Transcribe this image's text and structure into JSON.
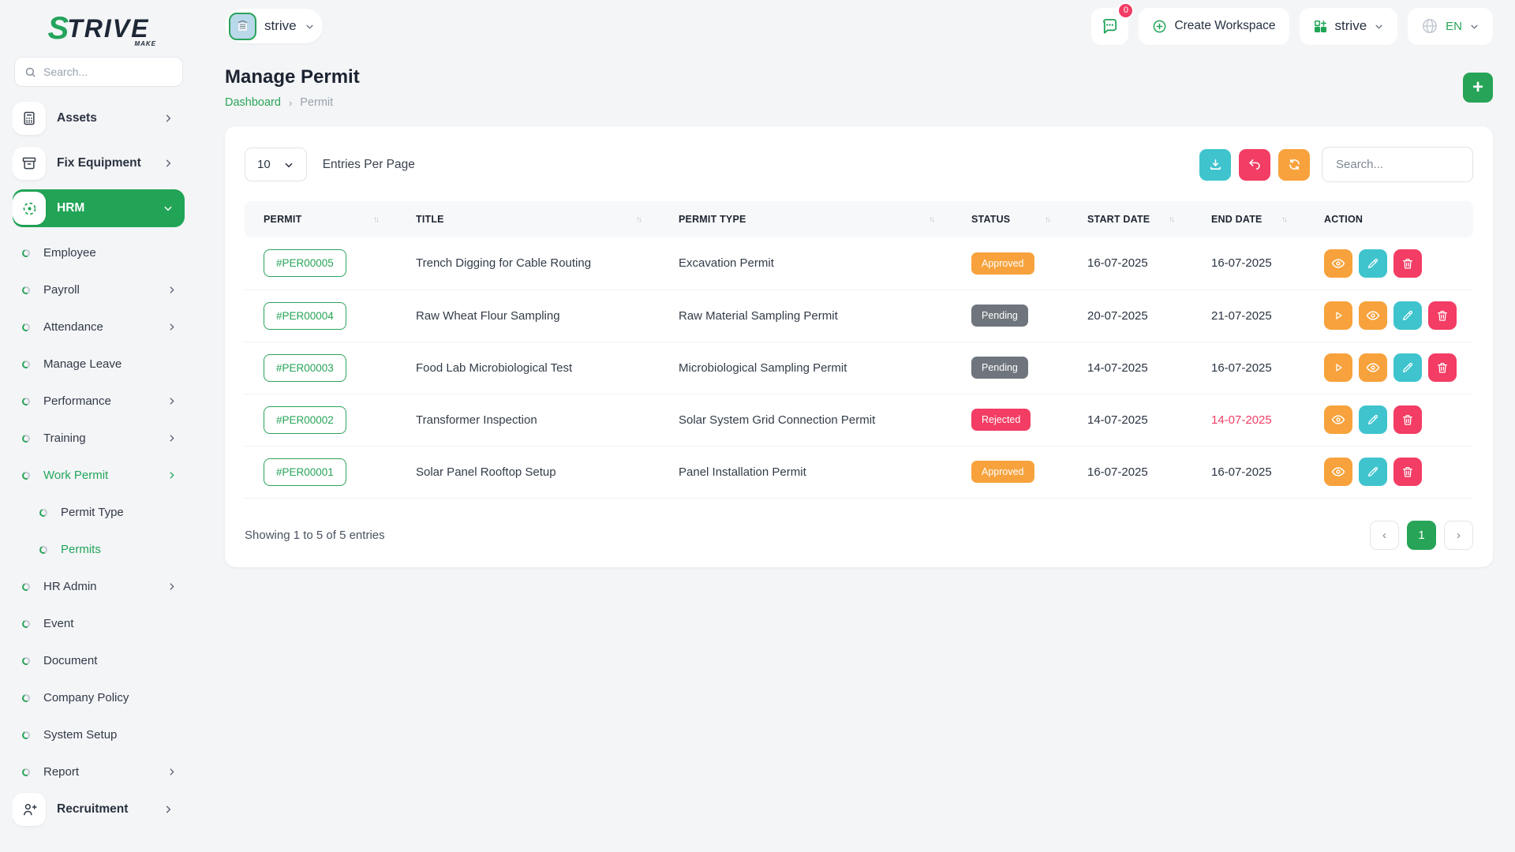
{
  "colors": {
    "primary_green": "#21a456",
    "orange": "#f7a23c",
    "teal": "#3fc4ce",
    "pink": "#f33d64",
    "badge_gray": "#6e757c"
  },
  "brand": {
    "logo_first": "S",
    "logo_rest": "TRIVE",
    "logo_sub": "MAKE"
  },
  "sidebar": {
    "search_placeholder": "Search...",
    "main": [
      {
        "label": "Assets",
        "icon": "calculator-icon",
        "chevron": "right",
        "active": false
      },
      {
        "label": "Fix Equipment",
        "icon": "archive-icon",
        "chevron": "right",
        "active": false
      },
      {
        "label": "HRM",
        "icon": "hub-icon",
        "chevron": "down",
        "active": true
      }
    ],
    "hrm_children": [
      {
        "label": "Employee",
        "chevron": false,
        "level": 1,
        "active": false
      },
      {
        "label": "Payroll",
        "chevron": true,
        "level": 1,
        "active": false
      },
      {
        "label": "Attendance",
        "chevron": true,
        "level": 1,
        "active": false
      },
      {
        "label": "Manage Leave",
        "chevron": false,
        "level": 1,
        "active": false
      },
      {
        "label": "Performance",
        "chevron": true,
        "level": 1,
        "active": false
      },
      {
        "label": "Training",
        "chevron": true,
        "level": 1,
        "active": false
      },
      {
        "label": "Work Permit",
        "chevron": true,
        "level": 1,
        "active": true
      },
      {
        "label": "Permit Type",
        "chevron": false,
        "level": 2,
        "active": false
      },
      {
        "label": "Permits",
        "chevron": false,
        "level": 2,
        "active": true
      },
      {
        "label": "HR Admin",
        "chevron": true,
        "level": 1,
        "active": false
      },
      {
        "label": "Event",
        "chevron": false,
        "level": 1,
        "active": false
      },
      {
        "label": "Document",
        "chevron": false,
        "level": 1,
        "active": false
      },
      {
        "label": "Company Policy",
        "chevron": false,
        "level": 1,
        "active": false
      },
      {
        "label": "System Setup",
        "chevron": false,
        "level": 1,
        "active": false
      },
      {
        "label": "Report",
        "chevron": true,
        "level": 1,
        "active": false
      }
    ],
    "footer_item": {
      "label": "Recruitment",
      "icon": "person-plus-icon",
      "chevron": "right"
    }
  },
  "header": {
    "workspace_chip_label": "strive",
    "chat_badge_count": "0",
    "create_workspace_label": "Create Workspace",
    "workspace_select_label": "strive",
    "language_label": "EN"
  },
  "page": {
    "title": "Manage Permit",
    "breadcrumb": [
      {
        "label": "Dashboard"
      },
      {
        "label": "Permit"
      }
    ]
  },
  "toolbar": {
    "entries_per_page_value": "10",
    "entries_per_page_label": "Entries Per Page",
    "buttons": [
      "download",
      "undo",
      "refresh"
    ],
    "search_placeholder": "Search..."
  },
  "table": {
    "headers": [
      {
        "label": "PERMIT",
        "sortable": true
      },
      {
        "label": "TITLE",
        "sortable": true
      },
      {
        "label": "PERMIT TYPE",
        "sortable": true
      },
      {
        "label": "STATUS",
        "sortable": true
      },
      {
        "label": "START DATE",
        "sortable": true
      },
      {
        "label": "END DATE",
        "sortable": true
      },
      {
        "label": "ACTION",
        "sortable": false
      }
    ],
    "rows": [
      {
        "permit": "#PER00005",
        "title": "Trench Digging for Cable Routing",
        "permit_type": "Excavation Permit",
        "status": "Approved",
        "start_date": "16-07-2025",
        "end_date": "16-07-2025",
        "end_date_overdue": false,
        "actions": [
          "view",
          "edit",
          "delete"
        ]
      },
      {
        "permit": "#PER00004",
        "title": "Raw Wheat Flour Sampling",
        "permit_type": "Raw Material Sampling Permit",
        "status": "Pending",
        "start_date": "20-07-2025",
        "end_date": "21-07-2025",
        "end_date_overdue": false,
        "actions": [
          "approve",
          "view",
          "edit",
          "delete"
        ]
      },
      {
        "permit": "#PER00003",
        "title": "Food Lab Microbiological Test",
        "permit_type": "Microbiological Sampling Permit",
        "status": "Pending",
        "start_date": "14-07-2025",
        "end_date": "16-07-2025",
        "end_date_overdue": false,
        "actions": [
          "approve",
          "view",
          "edit",
          "delete"
        ]
      },
      {
        "permit": "#PER00002",
        "title": "Transformer Inspection",
        "permit_type": "Solar System Grid Connection Permit",
        "status": "Rejected",
        "start_date": "14-07-2025",
        "end_date": "14-07-2025",
        "end_date_overdue": true,
        "actions": [
          "view",
          "edit",
          "delete"
        ]
      },
      {
        "permit": "#PER00001",
        "title": "Solar Panel Rooftop Setup",
        "permit_type": "Panel Installation Permit",
        "status": "Approved",
        "start_date": "16-07-2025",
        "end_date": "16-07-2025",
        "end_date_overdue": false,
        "actions": [
          "view",
          "edit",
          "delete"
        ]
      }
    ]
  },
  "footer": {
    "showing_text": "Showing 1 to 5 of 5 entries",
    "pagination": {
      "prev": "‹",
      "current": "1",
      "next": "›"
    }
  }
}
